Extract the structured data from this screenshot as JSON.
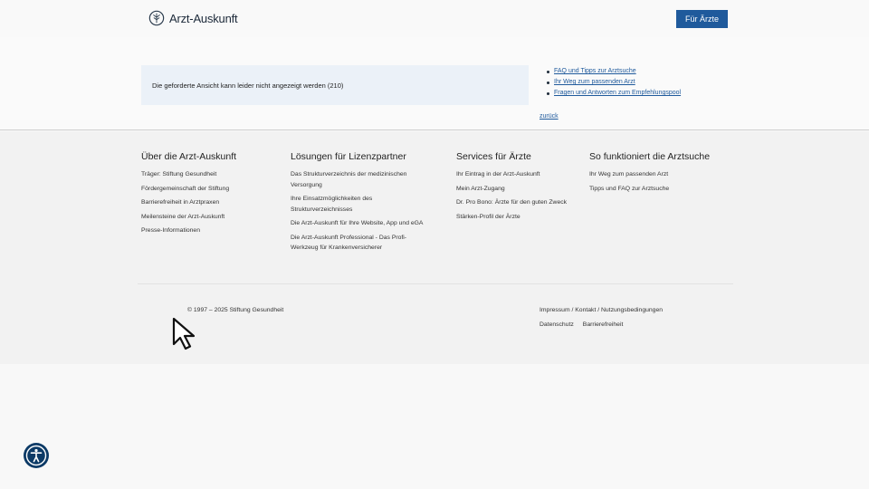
{
  "header": {
    "logo_text": "Arzt-Auskunft",
    "button_label": "Für Ärzte"
  },
  "main": {
    "notice": "Die geforderte Ansicht kann leider nicht angezeigt werden (210)",
    "links": [
      "FAQ und Tipps zur Arztsuche",
      "Ihr Weg zum passenden Arzt",
      "Fragen und Antworten zum Empfehlungspool"
    ],
    "back": "zurück"
  },
  "footer": {
    "columns": [
      {
        "title": "Über die Arzt-Auskunft",
        "items": [
          "Träger: Stiftung Gesundheit",
          "Fördergemeinschaft der Stiftung",
          "Barrierefreiheit in Arztpraxen",
          "Meilensteine der Arzt-Auskunft",
          "Presse-Informationen"
        ]
      },
      {
        "title": "Lösungen für Lizenzpartner",
        "items": [
          "Das Strukturverzeichnis der medizinischen Versorgung",
          "Ihre Einsatzmöglichkeiten des Strukturverzeichnisses",
          "Die Arzt-Auskunft für Ihre Website, App und eGA",
          "Die Arzt-Auskunft Professional - Das Profi-Werkzeug für Krankenversicherer"
        ]
      },
      {
        "title": "Services für Ärzte",
        "items": [
          "Ihr Eintrag in der Arzt-Auskunft",
          "Mein Arzt-Zugang",
          "Dr. Pro Bono: Ärzte für den guten Zweck",
          "Stärken-Profil der Ärzte"
        ]
      },
      {
        "title": "So funktioniert die Arztsuche",
        "items": [
          "Ihr Weg zum passenden Arzt",
          "Tipps und FAQ zur Arztsuche"
        ]
      }
    ],
    "copyright": "© 1997 – 2025 Stiftung Gesundheit",
    "legal_line": "Impressum / Kontakt / Nutzungsbedingungen",
    "datenschutz": "Datenschutz",
    "barrierefreiheit": "Barrierefreiheit"
  },
  "icons": {
    "logo": "globe-tree-icon",
    "cursor": "mouse-pointer-icon",
    "accessibility": "accessibility-icon"
  },
  "colors": {
    "primary": "#1f5a9c",
    "notice_bg": "#ebf1f8",
    "a11y_bg": "#0c3a66"
  }
}
